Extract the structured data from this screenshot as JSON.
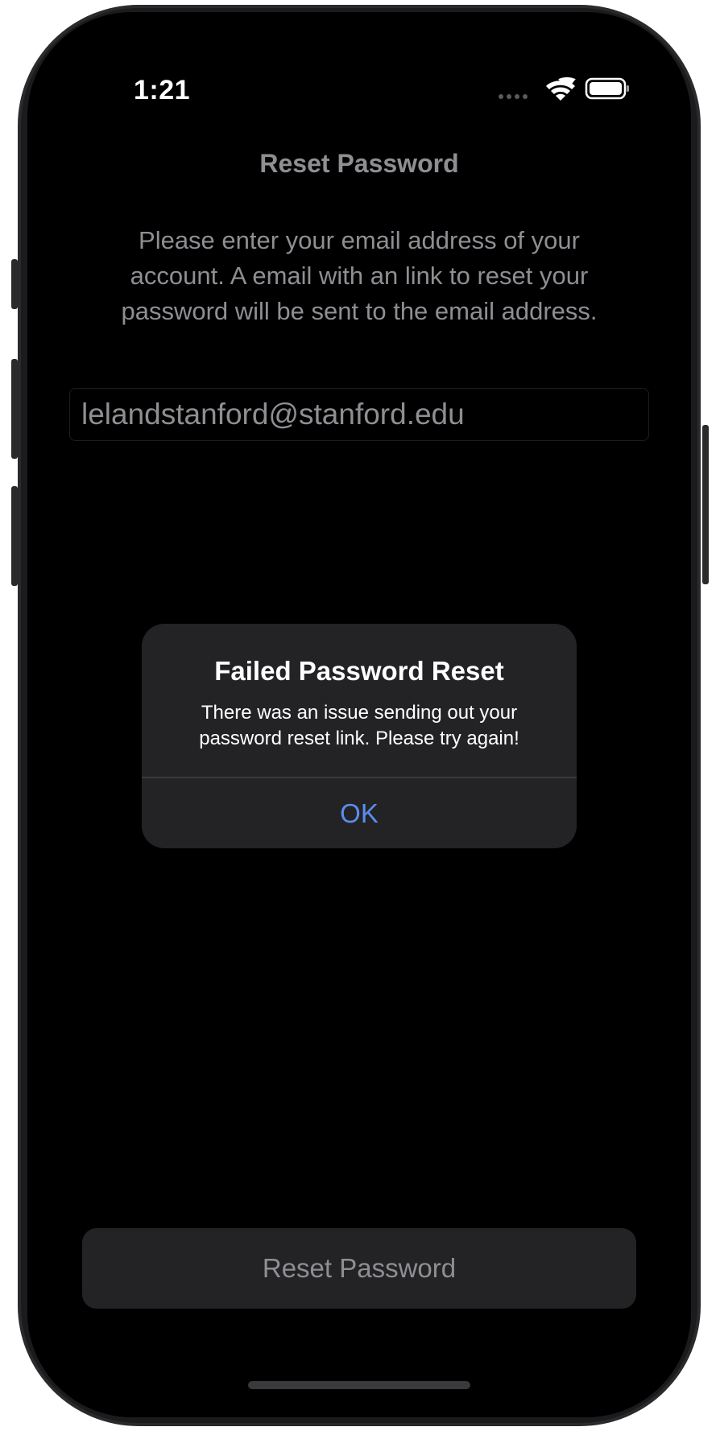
{
  "status_bar": {
    "time": "1:21",
    "icons": [
      "signal-dots-icon",
      "wifi-icon",
      "battery-icon"
    ]
  },
  "nav": {
    "title": "Reset Password"
  },
  "content": {
    "description": "Please enter your email address of your account. A email with an link to reset your password will be sent to the email address.",
    "email_value": "lelandstanford@stanford.edu"
  },
  "alert": {
    "title": "Failed Password Reset",
    "message": "There was an issue sending out your password reset link. Please try again!",
    "ok_label": "OK"
  },
  "footer": {
    "button_label": "Reset Password"
  },
  "colors": {
    "background": "#000000",
    "secondary_text": "#8e8e93",
    "alert_background": "#232325",
    "accent": "#5b8def"
  }
}
